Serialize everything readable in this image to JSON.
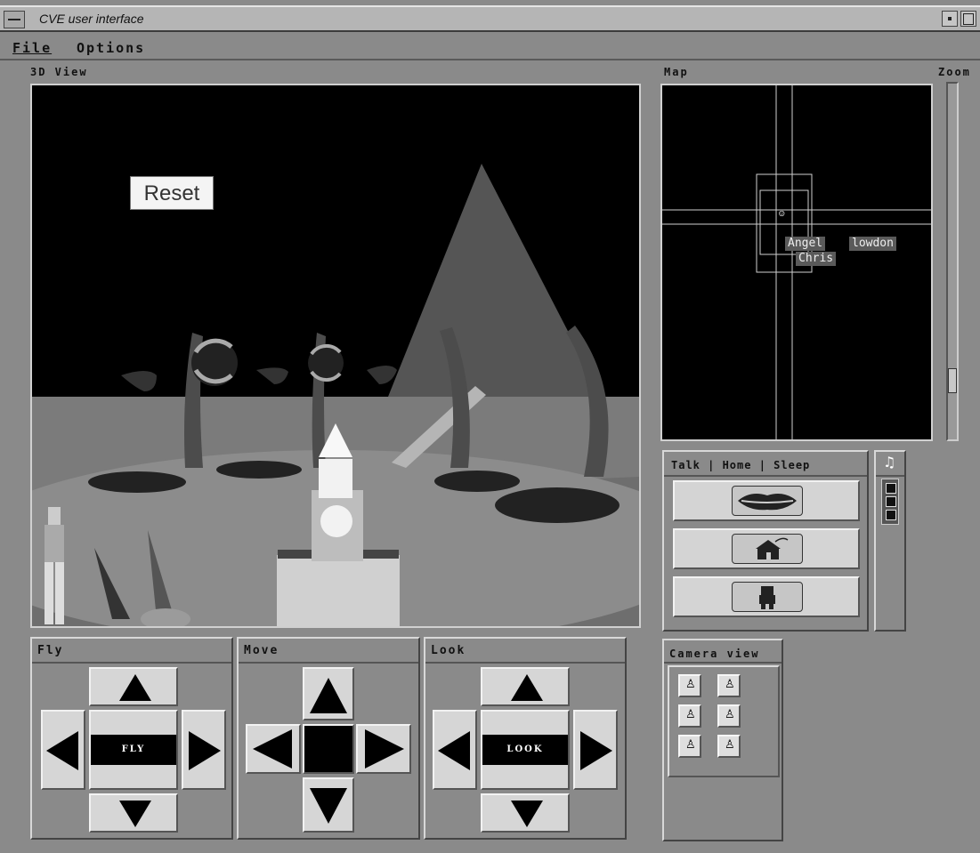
{
  "window": {
    "title": "CVE user interface"
  },
  "menu": [
    {
      "label": "File"
    },
    {
      "label": "Options"
    }
  ],
  "panels": {
    "view3d": "3D View",
    "map": "Map",
    "zoom": "Zoom"
  },
  "scene": {
    "reset_label": "Reset"
  },
  "map_labels": {
    "angel": "Angel",
    "lowdon": "lowdon",
    "chris": "Chris"
  },
  "actions": {
    "header": "Talk | Home | Sleep",
    "items": [
      {
        "icon": "lips-icon"
      },
      {
        "icon": "house-icon"
      },
      {
        "icon": "robot-sleep-icon"
      }
    ]
  },
  "audio": {
    "icon": "music-note-icon"
  },
  "nav": {
    "fly": {
      "title": "Fly",
      "center": "FLY"
    },
    "move": {
      "title": "Move"
    },
    "look": {
      "title": "Look",
      "center": "LOOK"
    }
  },
  "camera": {
    "title": "Camera view"
  },
  "zoom_level": 0.86
}
